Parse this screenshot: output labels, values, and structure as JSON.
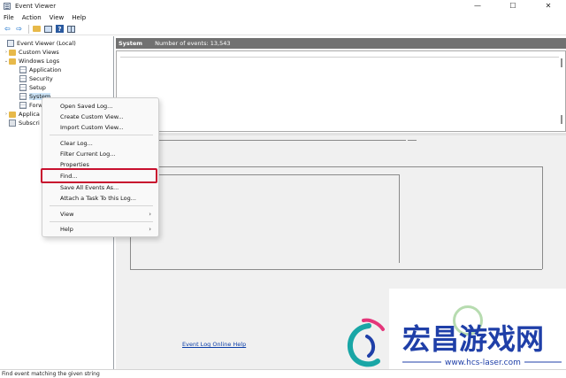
{
  "window": {
    "title": "Event Viewer",
    "controls": {
      "minimize": "—",
      "maximize": "☐",
      "close": "✕"
    }
  },
  "menubar": {
    "items": [
      "File",
      "Action",
      "View",
      "Help"
    ]
  },
  "toolbar": {
    "buttons": [
      "back-icon",
      "forward-icon",
      "folder-up-icon",
      "show-pane-icon",
      "help-icon",
      "properties-grid-icon"
    ],
    "back_glyph": "⇦",
    "forward_glyph": "⇨",
    "help_glyph": "?"
  },
  "tree": {
    "root": "Event Viewer (Local)",
    "custom_views": "Custom Views",
    "windows_logs": "Windows Logs",
    "application": "Application",
    "security": "Security",
    "setup": "Setup",
    "system": "System",
    "forwarded": "Forw",
    "applications": "Applica",
    "subscriptions": "Subscri"
  },
  "header": {
    "log_name": "System",
    "event_count": "Number of events: 13,543"
  },
  "detail": {
    "help_link": "Event Log Online Help"
  },
  "context_menu": {
    "items": [
      {
        "label": "Open Saved Log..."
      },
      {
        "label": "Create Custom View..."
      },
      {
        "label": "Import Custom View..."
      },
      {
        "label": "Clear Log..."
      },
      {
        "label": "Filter Current Log..."
      },
      {
        "label": "Properties"
      },
      {
        "label": "Find..."
      },
      {
        "label": "Save All Events As..."
      },
      {
        "label": "Attach a Task To this Log..."
      },
      {
        "label": "View",
        "submenu": true
      },
      {
        "label": "Help",
        "submenu": true
      }
    ],
    "submenu_glyph": "›",
    "highlight_color": "#c8102e"
  },
  "status": {
    "text": "Find event matching the given string"
  },
  "watermark": {
    "text": "宏昌游戏网",
    "url": "www.hcs-laser.com",
    "colors": {
      "primary": "#1f3fa8",
      "accent": "#19a6a6",
      "pink": "#e4367a"
    }
  },
  "colors": {
    "header_bg": "#717171",
    "selection": "#cce4f7",
    "link": "#0b3ea8"
  }
}
